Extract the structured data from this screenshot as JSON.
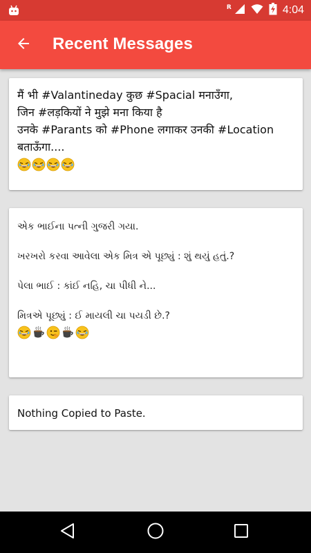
{
  "status_bar": {
    "time": "4:04",
    "roaming_indicator": "R",
    "icons": [
      "android-debug-icon",
      "signal-icon",
      "wifi-icon",
      "battery-charging-icon"
    ]
  },
  "app_bar": {
    "title": "Recent Messages",
    "back_icon": "arrow-back-icon",
    "background": "#f34a3f",
    "status_background": "#d73a32"
  },
  "messages": [
    {
      "lines": [
        "मैं भी #Valantineday कुछ #Spacial मनाउँगा,",
        "जिन #लड़कियों ने मुझे मना किया है",
        "उनके #Parants को #Phone लगाकर उनकी #Location",
        "बताऊँगा...."
      ],
      "emojis": [
        "laughing-emoji",
        "laughing-emoji",
        "laughing-emoji",
        "laughing-emoji"
      ]
    },
    {
      "lines": [
        "એક ભાઈના પત્ની ગુજરી ગયા.",
        "",
        "ખરખરો કરવા આવેલા એક મિત્ર એ પૂછ્યું : શું થયું હતું.?",
        "",
        "પેલા ભાઈ : કાંઈ નહિ, ચા પીધી ને...",
        "",
        "મિત્રએ પૂછ્યું : ઈ માયલી ચા પયડી છે.?"
      ],
      "emojis": [
        "laughing-emoji",
        "hot-beverage-emoji",
        "winking-emoji",
        "hot-beverage-emoji",
        "laughing-emoji"
      ]
    },
    {
      "lines": [
        "Nothing Copied to Paste."
      ],
      "emojis": []
    }
  ],
  "nav_bar": {
    "buttons": [
      "back-triangle-icon",
      "home-circle-icon",
      "recents-square-icon"
    ]
  }
}
